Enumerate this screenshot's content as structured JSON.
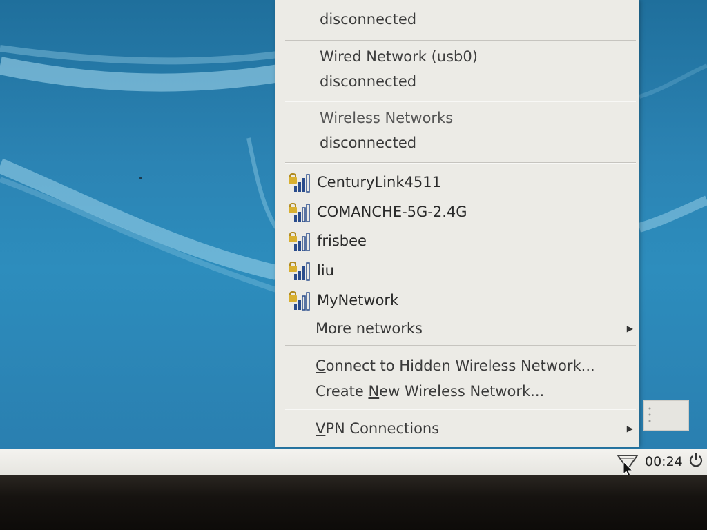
{
  "menu": {
    "header_partial": "disconnected",
    "wired_usb": {
      "title": "Wired Network (usb0)",
      "status": "disconnected"
    },
    "wireless": {
      "title": "Wireless Networks",
      "status": "disconnected"
    },
    "networks": [
      {
        "name": "CenturyLink4511"
      },
      {
        "name": "COMANCHE-5G-2.4G"
      },
      {
        "name": "frisbee"
      },
      {
        "name": "liu"
      },
      {
        "name": "MyNetwork"
      }
    ],
    "more_networks": "More networks",
    "hidden_prefix": "C",
    "hidden_rest": "onnect to Hidden Wireless Network...",
    "create_a": "Create ",
    "create_u": "N",
    "create_b": "ew Wireless Network...",
    "vpn_u": "V",
    "vpn_rest": "PN Connections"
  },
  "panel": {
    "clock": "00:24"
  },
  "colors": {
    "menu_bg": "#ecebe6",
    "desktop": "#2b83b3",
    "lock": "#d9b030",
    "bars": "#2a4c8c"
  }
}
